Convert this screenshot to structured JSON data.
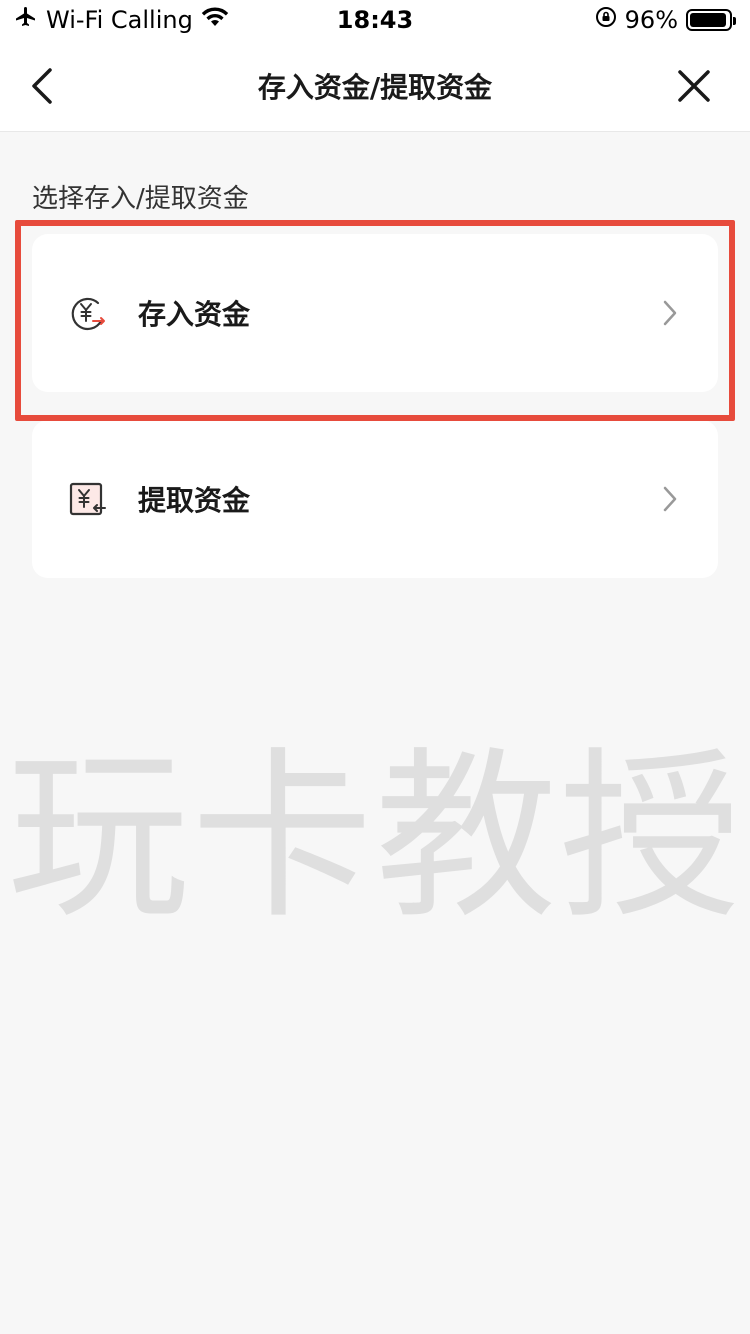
{
  "status_bar": {
    "carrier": "Wi-Fi Calling",
    "time": "18:43",
    "battery": "96%",
    "battery_level": 0.96,
    "icons": [
      "airplane-icon",
      "wifi-icon",
      "orientation-lock-icon",
      "battery-icon"
    ]
  },
  "nav": {
    "title": "存入资金/提取资金",
    "back_icon": "chevron-left-icon",
    "close_icon": "close-icon"
  },
  "section": {
    "label": "选择存入/提取资金"
  },
  "options": [
    {
      "label": "存入资金",
      "icon": "deposit-yen-icon"
    },
    {
      "label": "提取资金",
      "icon": "withdraw-yen-icon"
    }
  ],
  "watermark": "玩卡教授",
  "colors": {
    "highlight": "#e74b3c",
    "background": "#f7f7f7",
    "card": "#ffffff"
  }
}
